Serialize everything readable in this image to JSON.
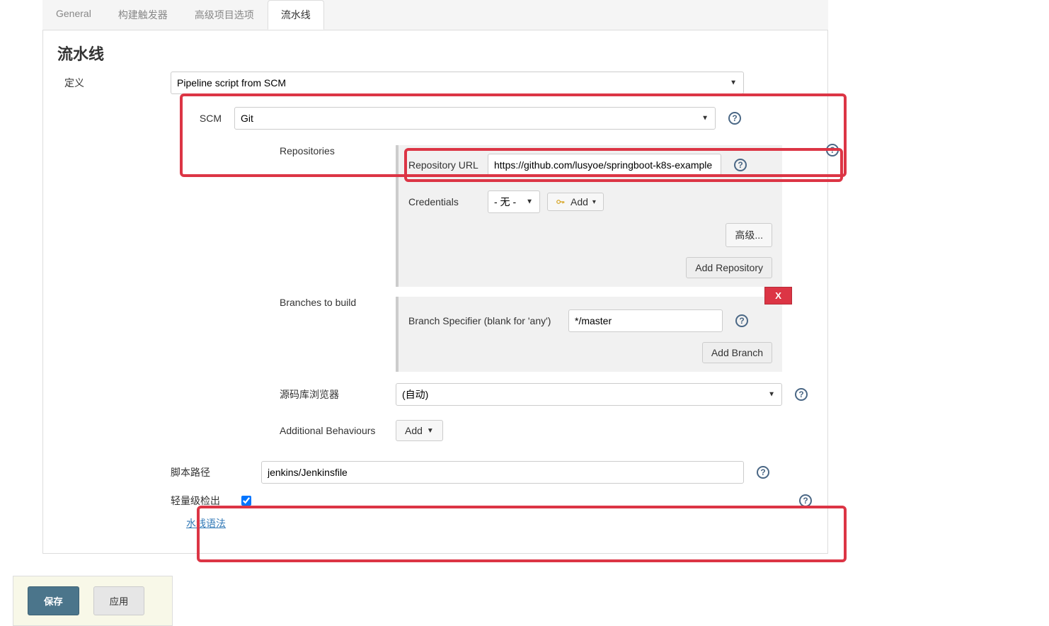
{
  "tabs": {
    "general": "General",
    "build_triggers": "构建触发器",
    "advanced_options": "高级项目选项",
    "pipeline": "流水线"
  },
  "section": {
    "title": "流水线",
    "definition_label": "定义",
    "definition_value": "Pipeline script from SCM",
    "scm_label": "SCM",
    "scm_value": "Git",
    "repositories_label": "Repositories",
    "repo_url_label": "Repository URL",
    "repo_url_value": "https://github.com/lusyoe/springboot-k8s-example",
    "credentials_label": "Credentials",
    "credentials_value": "- 无 -",
    "add_button": "Add",
    "advanced_button": "高级...",
    "add_repo_button": "Add Repository",
    "branches_label": "Branches to build",
    "branch_specifier_label": "Branch Specifier (blank for 'any')",
    "branch_specifier_value": "*/master",
    "delete_x": "X",
    "add_branch_button": "Add Branch",
    "source_browser_label": "源码库浏览器",
    "source_browser_value": "(自动)",
    "additional_behaviours_label": "Additional Behaviours",
    "additional_behaviours_add": "Add",
    "script_path_label": "脚本路径",
    "script_path_value": "jenkins/Jenkinsfile",
    "lightweight_label": "轻量级检出",
    "lightweight_checked": true,
    "pipeline_syntax_link": "水线语法"
  },
  "footer": {
    "save": "保存",
    "apply": "应用"
  }
}
